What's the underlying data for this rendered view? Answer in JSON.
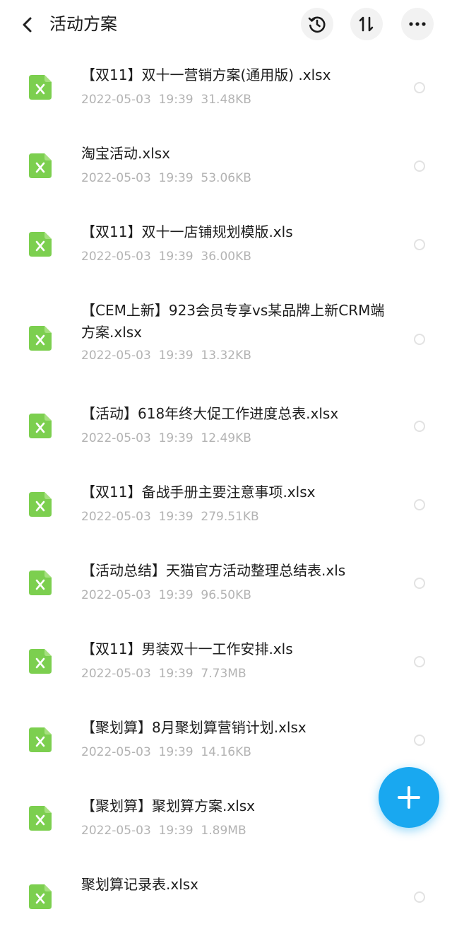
{
  "header": {
    "title": "活动方案",
    "back_icon": "chevron-left-icon",
    "history_icon": "history-icon",
    "sort_icon": "sort-icon",
    "more_icon": "more-icon"
  },
  "colors": {
    "file_icon_green": "#7ccf4f",
    "meta_text": "#b3b3b3",
    "fab_blue": "#19a8f0"
  },
  "files": [
    {
      "name": "【双11】双十一营销方案(通用版) .xlsx",
      "date": "2022-05-03",
      "time": "19:39",
      "size": "31.48KB"
    },
    {
      "name": "淘宝活动.xlsx",
      "date": "2022-05-03",
      "time": "19:39",
      "size": "53.06KB"
    },
    {
      "name": "【双11】双十一店铺规划模版.xls",
      "date": "2022-05-03",
      "time": "19:39",
      "size": "36.00KB"
    },
    {
      "name": "【CEM上新】923会员专享vs某品牌上新CRM端方案.xlsx",
      "date": "2022-05-03",
      "time": "19:39",
      "size": "13.32KB"
    },
    {
      "name": "【活动】618年终大促工作进度总表.xlsx",
      "date": "2022-05-03",
      "time": "19:39",
      "size": "12.49KB"
    },
    {
      "name": "【双11】备战手册主要注意事项.xlsx",
      "date": "2022-05-03",
      "time": "19:39",
      "size": "279.51KB"
    },
    {
      "name": "【活动总结】天猫官方活动整理总结表.xls",
      "date": "2022-05-03",
      "time": "19:39",
      "size": "96.50KB"
    },
    {
      "name": "【双11】男装双十一工作安排.xls",
      "date": "2022-05-03",
      "time": "19:39",
      "size": "7.73MB"
    },
    {
      "name": "【聚划算】8月聚划算营销计划.xlsx",
      "date": "2022-05-03",
      "time": "19:39",
      "size": "14.16KB"
    },
    {
      "name": "【聚划算】聚划算方案.xlsx",
      "date": "2022-05-03",
      "time": "19:39",
      "size": "1.89MB"
    },
    {
      "name": "聚划算记录表.xlsx",
      "date": "",
      "time": "",
      "size": ""
    }
  ],
  "fab": {
    "icon": "plus-icon"
  }
}
